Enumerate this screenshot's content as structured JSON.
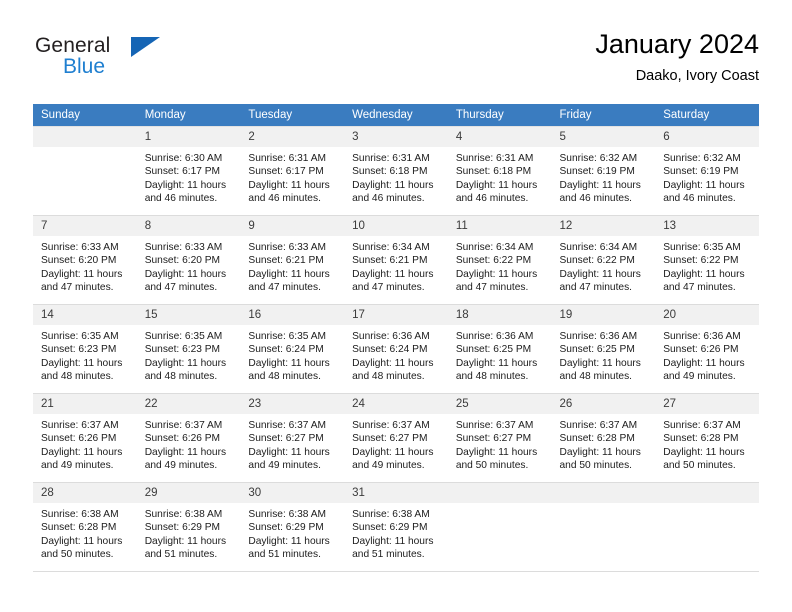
{
  "brand": {
    "name_top": "General",
    "name_bottom": "Blue",
    "triangle_color": "#1565b5",
    "blue_color": "#1f7fd0"
  },
  "header": {
    "title": "January 2024",
    "subtitle": "Daako, Ivory Coast"
  },
  "theme": {
    "header_row_bg": "#3a7cc0",
    "header_row_text": "#ffffff",
    "daynum_bg": "#f1f1f1",
    "grid_line": "#dcdcdc"
  },
  "weekday_headers": [
    "Sunday",
    "Monday",
    "Tuesday",
    "Wednesday",
    "Thursday",
    "Friday",
    "Saturday"
  ],
  "weeks": [
    [
      {
        "day": "",
        "blank": true,
        "sunrise": "",
        "sunset": "",
        "daylight1": "",
        "daylight2": ""
      },
      {
        "day": "1",
        "blank": false,
        "sunrise": "Sunrise: 6:30 AM",
        "sunset": "Sunset: 6:17 PM",
        "daylight1": "Daylight: 11 hours",
        "daylight2": "and 46 minutes."
      },
      {
        "day": "2",
        "blank": false,
        "sunrise": "Sunrise: 6:31 AM",
        "sunset": "Sunset: 6:17 PM",
        "daylight1": "Daylight: 11 hours",
        "daylight2": "and 46 minutes."
      },
      {
        "day": "3",
        "blank": false,
        "sunrise": "Sunrise: 6:31 AM",
        "sunset": "Sunset: 6:18 PM",
        "daylight1": "Daylight: 11 hours",
        "daylight2": "and 46 minutes."
      },
      {
        "day": "4",
        "blank": false,
        "sunrise": "Sunrise: 6:31 AM",
        "sunset": "Sunset: 6:18 PM",
        "daylight1": "Daylight: 11 hours",
        "daylight2": "and 46 minutes."
      },
      {
        "day": "5",
        "blank": false,
        "sunrise": "Sunrise: 6:32 AM",
        "sunset": "Sunset: 6:19 PM",
        "daylight1": "Daylight: 11 hours",
        "daylight2": "and 46 minutes."
      },
      {
        "day": "6",
        "blank": false,
        "sunrise": "Sunrise: 6:32 AM",
        "sunset": "Sunset: 6:19 PM",
        "daylight1": "Daylight: 11 hours",
        "daylight2": "and 46 minutes."
      }
    ],
    [
      {
        "day": "7",
        "blank": false,
        "sunrise": "Sunrise: 6:33 AM",
        "sunset": "Sunset: 6:20 PM",
        "daylight1": "Daylight: 11 hours",
        "daylight2": "and 47 minutes."
      },
      {
        "day": "8",
        "blank": false,
        "sunrise": "Sunrise: 6:33 AM",
        "sunset": "Sunset: 6:20 PM",
        "daylight1": "Daylight: 11 hours",
        "daylight2": "and 47 minutes."
      },
      {
        "day": "9",
        "blank": false,
        "sunrise": "Sunrise: 6:33 AM",
        "sunset": "Sunset: 6:21 PM",
        "daylight1": "Daylight: 11 hours",
        "daylight2": "and 47 minutes."
      },
      {
        "day": "10",
        "blank": false,
        "sunrise": "Sunrise: 6:34 AM",
        "sunset": "Sunset: 6:21 PM",
        "daylight1": "Daylight: 11 hours",
        "daylight2": "and 47 minutes."
      },
      {
        "day": "11",
        "blank": false,
        "sunrise": "Sunrise: 6:34 AM",
        "sunset": "Sunset: 6:22 PM",
        "daylight1": "Daylight: 11 hours",
        "daylight2": "and 47 minutes."
      },
      {
        "day": "12",
        "blank": false,
        "sunrise": "Sunrise: 6:34 AM",
        "sunset": "Sunset: 6:22 PM",
        "daylight1": "Daylight: 11 hours",
        "daylight2": "and 47 minutes."
      },
      {
        "day": "13",
        "blank": false,
        "sunrise": "Sunrise: 6:35 AM",
        "sunset": "Sunset: 6:22 PM",
        "daylight1": "Daylight: 11 hours",
        "daylight2": "and 47 minutes."
      }
    ],
    [
      {
        "day": "14",
        "blank": false,
        "sunrise": "Sunrise: 6:35 AM",
        "sunset": "Sunset: 6:23 PM",
        "daylight1": "Daylight: 11 hours",
        "daylight2": "and 48 minutes."
      },
      {
        "day": "15",
        "blank": false,
        "sunrise": "Sunrise: 6:35 AM",
        "sunset": "Sunset: 6:23 PM",
        "daylight1": "Daylight: 11 hours",
        "daylight2": "and 48 minutes."
      },
      {
        "day": "16",
        "blank": false,
        "sunrise": "Sunrise: 6:35 AM",
        "sunset": "Sunset: 6:24 PM",
        "daylight1": "Daylight: 11 hours",
        "daylight2": "and 48 minutes."
      },
      {
        "day": "17",
        "blank": false,
        "sunrise": "Sunrise: 6:36 AM",
        "sunset": "Sunset: 6:24 PM",
        "daylight1": "Daylight: 11 hours",
        "daylight2": "and 48 minutes."
      },
      {
        "day": "18",
        "blank": false,
        "sunrise": "Sunrise: 6:36 AM",
        "sunset": "Sunset: 6:25 PM",
        "daylight1": "Daylight: 11 hours",
        "daylight2": "and 48 minutes."
      },
      {
        "day": "19",
        "blank": false,
        "sunrise": "Sunrise: 6:36 AM",
        "sunset": "Sunset: 6:25 PM",
        "daylight1": "Daylight: 11 hours",
        "daylight2": "and 48 minutes."
      },
      {
        "day": "20",
        "blank": false,
        "sunrise": "Sunrise: 6:36 AM",
        "sunset": "Sunset: 6:26 PM",
        "daylight1": "Daylight: 11 hours",
        "daylight2": "and 49 minutes."
      }
    ],
    [
      {
        "day": "21",
        "blank": false,
        "sunrise": "Sunrise: 6:37 AM",
        "sunset": "Sunset: 6:26 PM",
        "daylight1": "Daylight: 11 hours",
        "daylight2": "and 49 minutes."
      },
      {
        "day": "22",
        "blank": false,
        "sunrise": "Sunrise: 6:37 AM",
        "sunset": "Sunset: 6:26 PM",
        "daylight1": "Daylight: 11 hours",
        "daylight2": "and 49 minutes."
      },
      {
        "day": "23",
        "blank": false,
        "sunrise": "Sunrise: 6:37 AM",
        "sunset": "Sunset: 6:27 PM",
        "daylight1": "Daylight: 11 hours",
        "daylight2": "and 49 minutes."
      },
      {
        "day": "24",
        "blank": false,
        "sunrise": "Sunrise: 6:37 AM",
        "sunset": "Sunset: 6:27 PM",
        "daylight1": "Daylight: 11 hours",
        "daylight2": "and 49 minutes."
      },
      {
        "day": "25",
        "blank": false,
        "sunrise": "Sunrise: 6:37 AM",
        "sunset": "Sunset: 6:27 PM",
        "daylight1": "Daylight: 11 hours",
        "daylight2": "and 50 minutes."
      },
      {
        "day": "26",
        "blank": false,
        "sunrise": "Sunrise: 6:37 AM",
        "sunset": "Sunset: 6:28 PM",
        "daylight1": "Daylight: 11 hours",
        "daylight2": "and 50 minutes."
      },
      {
        "day": "27",
        "blank": false,
        "sunrise": "Sunrise: 6:37 AM",
        "sunset": "Sunset: 6:28 PM",
        "daylight1": "Daylight: 11 hours",
        "daylight2": "and 50 minutes."
      }
    ],
    [
      {
        "day": "28",
        "blank": false,
        "sunrise": "Sunrise: 6:38 AM",
        "sunset": "Sunset: 6:28 PM",
        "daylight1": "Daylight: 11 hours",
        "daylight2": "and 50 minutes."
      },
      {
        "day": "29",
        "blank": false,
        "sunrise": "Sunrise: 6:38 AM",
        "sunset": "Sunset: 6:29 PM",
        "daylight1": "Daylight: 11 hours",
        "daylight2": "and 51 minutes."
      },
      {
        "day": "30",
        "blank": false,
        "sunrise": "Sunrise: 6:38 AM",
        "sunset": "Sunset: 6:29 PM",
        "daylight1": "Daylight: 11 hours",
        "daylight2": "and 51 minutes."
      },
      {
        "day": "31",
        "blank": false,
        "sunrise": "Sunrise: 6:38 AM",
        "sunset": "Sunset: 6:29 PM",
        "daylight1": "Daylight: 11 hours",
        "daylight2": "and 51 minutes."
      },
      {
        "day": "",
        "blank": true,
        "sunrise": "",
        "sunset": "",
        "daylight1": "",
        "daylight2": ""
      },
      {
        "day": "",
        "blank": true,
        "sunrise": "",
        "sunset": "",
        "daylight1": "",
        "daylight2": ""
      },
      {
        "day": "",
        "blank": true,
        "sunrise": "",
        "sunset": "",
        "daylight1": "",
        "daylight2": ""
      }
    ]
  ]
}
